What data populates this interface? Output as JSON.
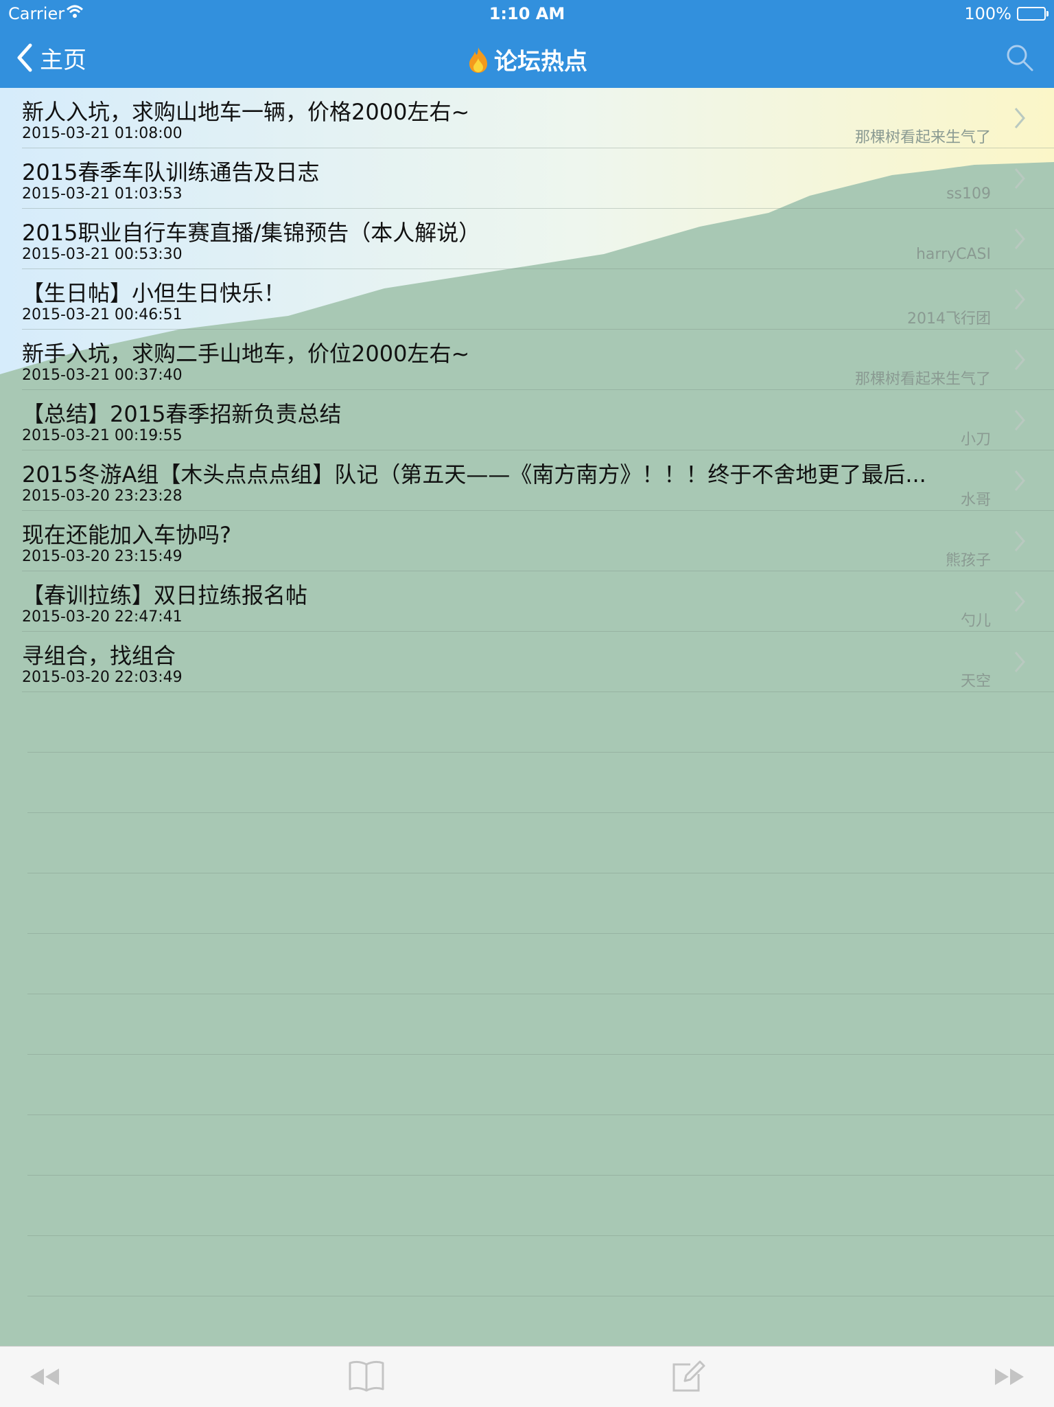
{
  "status_bar": {
    "carrier": "Carrier",
    "time": "1:10 AM",
    "battery": "100%"
  },
  "nav": {
    "back_label": "主页",
    "title": "论坛热点",
    "title_icon": "fire-icon",
    "search_icon": "search-icon"
  },
  "threads": [
    {
      "title": "新人入坑，求购山地车一辆，价格2000左右~",
      "date": "2015-03-21 01:08:00",
      "author": "那棵树看起来生气了"
    },
    {
      "title": "2015春季车队训练通告及日志",
      "date": "2015-03-21 01:03:53",
      "author": "ss109"
    },
    {
      "title": "2015职业自行车赛直播/集锦预告（本人解说）",
      "date": "2015-03-21 00:53:30",
      "author": "harryCASI"
    },
    {
      "title": "【生日帖】小但生日快乐！",
      "date": "2015-03-21 00:46:51",
      "author": "2014飞行团"
    },
    {
      "title": "新手入坑，求购二手山地车，价位2000左右~",
      "date": "2015-03-21 00:37:40",
      "author": "那棵树看起来生气了"
    },
    {
      "title": "【总结】2015春季招新负责总结",
      "date": "2015-03-21 00:19:55",
      "author": "小刀"
    },
    {
      "title": "2015冬游A组【木头点点点组】队记（第五天——《南方南方》！！！终于不舍地更了最后...",
      "date": "2015-03-20 23:23:28",
      "author": "水哥"
    },
    {
      "title": "现在还能加入车协吗?",
      "date": "2015-03-20 23:15:49",
      "author": "熊孩子"
    },
    {
      "title": "【春训拉练】双日拉练报名帖",
      "date": "2015-03-20 22:47:41",
      "author": "勺儿"
    },
    {
      "title": "寻组合，找组合",
      "date": "2015-03-20 22:03:49",
      "author": "天空"
    }
  ],
  "toolbar": {
    "rewind_icon": "rewind-icon",
    "book_icon": "book-icon",
    "compose_icon": "compose-icon",
    "forward_icon": "fast-forward-icon"
  },
  "colors": {
    "nav_bg": "#3290dd",
    "hill": "#a8c8b4",
    "sky": "#dceefc"
  }
}
